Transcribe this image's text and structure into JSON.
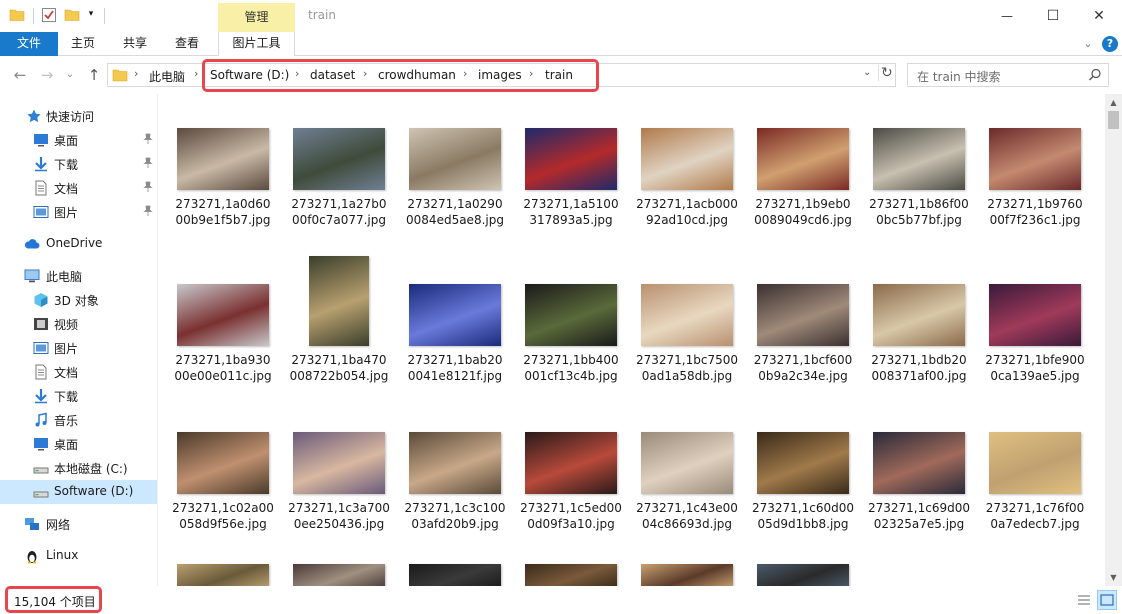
{
  "window": {
    "title": "train",
    "context_tab": "管理",
    "minimize_glyph": "—",
    "maximize_glyph": "☐",
    "close_glyph": "✕"
  },
  "ribbon": {
    "tabs": [
      "文件",
      "主页",
      "共享",
      "查看",
      "图片工具"
    ],
    "help_glyph": "?"
  },
  "address": {
    "segments": [
      "此电脑",
      "Software (D:)",
      "dataset",
      "crowdhuman",
      "images",
      "train"
    ],
    "separator": "›"
  },
  "search": {
    "placeholder": "在 train 中搜索"
  },
  "sidebar": {
    "items": [
      {
        "label": "快速访问",
        "icon": "star-icon"
      },
      {
        "label": "桌面",
        "icon": "desktop-icon",
        "pinned": true
      },
      {
        "label": "下载",
        "icon": "download-icon",
        "pinned": true
      },
      {
        "label": "文档",
        "icon": "document-icon",
        "pinned": true
      },
      {
        "label": "图片",
        "icon": "picture-icon",
        "pinned": true
      },
      {
        "label": "OneDrive",
        "icon": "cloud-icon"
      },
      {
        "label": "此电脑",
        "icon": "computer-icon"
      },
      {
        "label": "3D 对象",
        "icon": "cube-icon"
      },
      {
        "label": "视频",
        "icon": "video-icon"
      },
      {
        "label": "图片",
        "icon": "picture-icon"
      },
      {
        "label": "文档",
        "icon": "document-icon"
      },
      {
        "label": "下载",
        "icon": "download-icon"
      },
      {
        "label": "音乐",
        "icon": "music-icon"
      },
      {
        "label": "桌面",
        "icon": "desktop-icon"
      },
      {
        "label": "本地磁盘 (C:)",
        "icon": "drive-icon"
      },
      {
        "label": "Software (D:)",
        "icon": "drive-icon",
        "selected": true
      },
      {
        "label": "网络",
        "icon": "network-icon"
      },
      {
        "label": "Linux",
        "icon": "linux-icon"
      }
    ]
  },
  "files": [
    {
      "name": "273271,1a0d6000b9e1f5b7.jpg",
      "colors": [
        "#5b4a3e",
        "#c9b9a6"
      ]
    },
    {
      "name": "273271,1a27b000f0c7a077.jpg",
      "colors": [
        "#6f7f94",
        "#3f4b3a"
      ]
    },
    {
      "name": "273271,1a02900084ed5ae8.jpg",
      "colors": [
        "#cfc4b3",
        "#8a7a63"
      ]
    },
    {
      "name": "273271,1a5100317893a5.jpg",
      "colors": [
        "#1e2a6b",
        "#b42a2a"
      ]
    },
    {
      "name": "273271,1acb00092ad10cd.jpg",
      "colors": [
        "#b07a4b",
        "#e0d3c2"
      ]
    },
    {
      "name": "273271,1b9eb00089049cd6.jpg",
      "colors": [
        "#7a2a24",
        "#d0a070"
      ]
    },
    {
      "name": "273271,1b86f000bc5b77bf.jpg",
      "colors": [
        "#4b4b44",
        "#c8c0b0"
      ]
    },
    {
      "name": "273271,1b976000f7f236c1.jpg",
      "colors": [
        "#6a2a2a",
        "#c48a70"
      ]
    },
    {
      "name": "273271,1ba93000e00e011c.jpg",
      "colors": [
        "#c8c8cc",
        "#7a3030"
      ]
    },
    {
      "name": "273271,1ba470008722b054.jpg",
      "colors": [
        "#3a3e2a",
        "#b8a070"
      ]
    },
    {
      "name": "273271,1bab200041e8121f.jpg",
      "colors": [
        "#1a2a7a",
        "#6a7adb"
      ]
    },
    {
      "name": "273271,1bb400001cf13c4b.jpg",
      "colors": [
        "#1a1a1a",
        "#5a6a3a"
      ]
    },
    {
      "name": "273271,1bc75000ad1a58db.jpg",
      "colors": [
        "#b89070",
        "#e8d8c0"
      ]
    },
    {
      "name": "273271,1bcf6000b9a2c34e.jpg",
      "colors": [
        "#3a3030",
        "#a08a7a"
      ]
    },
    {
      "name": "273271,1bdb20008371af00.jpg",
      "colors": [
        "#8a6a4a",
        "#d8c8a8"
      ]
    },
    {
      "name": "273271,1bfe9000ca139ae5.jpg",
      "colors": [
        "#3a1a3a",
        "#a03a5a"
      ]
    },
    {
      "name": "273271,1c02a00058d9f56e.jpg",
      "colors": [
        "#4a3a2a",
        "#c09070"
      ]
    },
    {
      "name": "273271,1c3a7000ee250436.jpg",
      "colors": [
        "#6a5a7a",
        "#d8b8a0"
      ]
    },
    {
      "name": "273271,1c3c10003afd20b9.jpg",
      "colors": [
        "#5a4a3a",
        "#c8a888"
      ]
    },
    {
      "name": "273271,1c5ed000d09f3a10.jpg",
      "colors": [
        "#2a1a1a",
        "#b84a3a"
      ]
    },
    {
      "name": "273271,1c43e0004c86693d.jpg",
      "colors": [
        "#9a8a7a",
        "#e0d0c0"
      ]
    },
    {
      "name": "273271,1c60d0005d9d1bb8.jpg",
      "colors": [
        "#3a2a1a",
        "#a07a4a"
      ]
    },
    {
      "name": "273271,1c69d0002325a7e5.jpg",
      "colors": [
        "#2a2a3a",
        "#a06a5a"
      ]
    },
    {
      "name": "273271,1c76f000a7edecb7.jpg",
      "colors": [
        "#e0c080",
        "#c0a070"
      ]
    },
    {
      "name": "",
      "colors": [
        "#b8a070",
        "#6a5a3a"
      ]
    },
    {
      "name": "",
      "colors": [
        "#4a3a3a",
        "#a09080"
      ]
    },
    {
      "name": "",
      "colors": [
        "#1a1a1a",
        "#3a3a3a"
      ]
    },
    {
      "name": "",
      "colors": [
        "#3a2a1a",
        "#7a5a3a"
      ]
    },
    {
      "name": "",
      "colors": [
        "#c8a070",
        "#5a3a2a"
      ]
    },
    {
      "name": "",
      "colors": [
        "#4a5a6a",
        "#2a2a2a"
      ]
    }
  ],
  "status": {
    "item_count": "15,104 个项目"
  }
}
